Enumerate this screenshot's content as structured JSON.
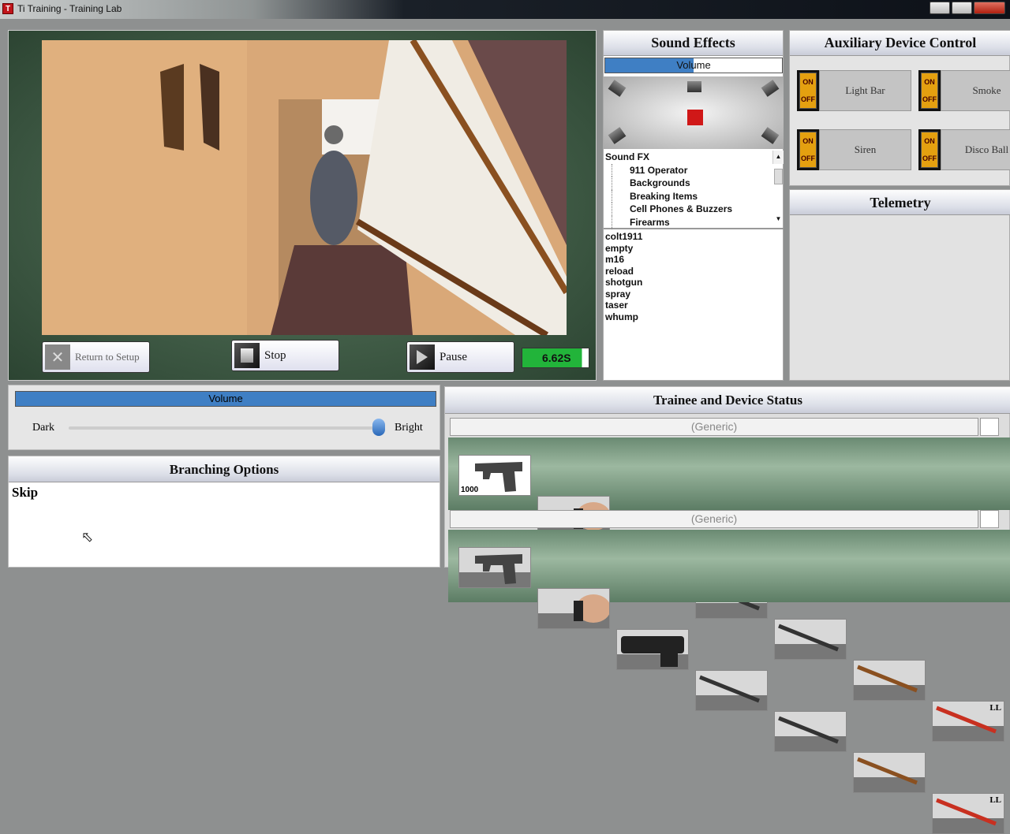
{
  "window": {
    "title": "Ti Training - Training Lab",
    "icon_letter": "T"
  },
  "video_controls": {
    "return_label": "Return to Setup",
    "stop_label": "Stop",
    "pause_label": "Pause",
    "elapsed": "6.62S"
  },
  "sound_effects": {
    "title": "Sound Effects",
    "volume_label": "Volume",
    "volume_fraction": 0.5,
    "tree": {
      "root": "Sound FX",
      "children": [
        "911 Operator",
        "Backgrounds",
        "Breaking Items",
        "Cell Phones & Buzzers",
        "Firearms"
      ]
    },
    "files": [
      "colt1911",
      "empty",
      "m16",
      "reload",
      "shotgun",
      "spray",
      "taser",
      "whump"
    ]
  },
  "aux": {
    "title": "Auxiliary Device Control",
    "switch_on": "ON",
    "switch_off": "OFF",
    "devices": [
      "Light Bar",
      "Smoke",
      "Siren",
      "Disco Ball"
    ]
  },
  "telemetry": {
    "title": "Telemetry"
  },
  "brightness": {
    "title": "Volume",
    "dark": "Dark",
    "bright": "Bright",
    "value_fraction": 0.98
  },
  "branching": {
    "title": "Branching Options",
    "options": [
      "Skip"
    ]
  },
  "status": {
    "title": "Trainee and Device Status",
    "trainees": [
      {
        "name": "(Generic)",
        "pistol_count": "1000",
        "ll_label": "LL"
      },
      {
        "name": "(Generic)",
        "ll_label": "LL"
      }
    ]
  }
}
